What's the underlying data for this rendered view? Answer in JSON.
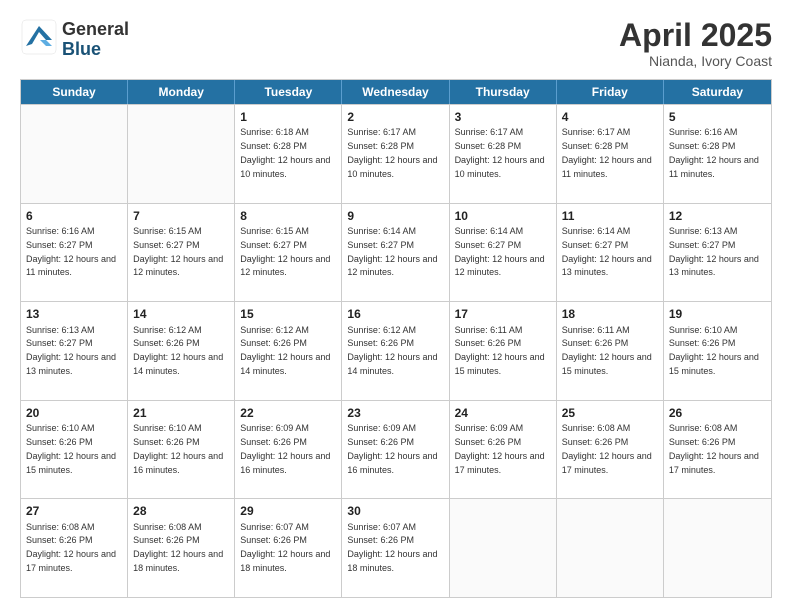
{
  "logo": {
    "general": "General",
    "blue": "Blue"
  },
  "title": "April 2025",
  "location": "Nianda, Ivory Coast",
  "header_days": [
    "Sunday",
    "Monday",
    "Tuesday",
    "Wednesday",
    "Thursday",
    "Friday",
    "Saturday"
  ],
  "weeks": [
    [
      {
        "day": "",
        "info": ""
      },
      {
        "day": "",
        "info": ""
      },
      {
        "day": "1",
        "info": "Sunrise: 6:18 AM\nSunset: 6:28 PM\nDaylight: 12 hours and 10 minutes."
      },
      {
        "day": "2",
        "info": "Sunrise: 6:17 AM\nSunset: 6:28 PM\nDaylight: 12 hours and 10 minutes."
      },
      {
        "day": "3",
        "info": "Sunrise: 6:17 AM\nSunset: 6:28 PM\nDaylight: 12 hours and 10 minutes."
      },
      {
        "day": "4",
        "info": "Sunrise: 6:17 AM\nSunset: 6:28 PM\nDaylight: 12 hours and 11 minutes."
      },
      {
        "day": "5",
        "info": "Sunrise: 6:16 AM\nSunset: 6:28 PM\nDaylight: 12 hours and 11 minutes."
      }
    ],
    [
      {
        "day": "6",
        "info": "Sunrise: 6:16 AM\nSunset: 6:27 PM\nDaylight: 12 hours and 11 minutes."
      },
      {
        "day": "7",
        "info": "Sunrise: 6:15 AM\nSunset: 6:27 PM\nDaylight: 12 hours and 12 minutes."
      },
      {
        "day": "8",
        "info": "Sunrise: 6:15 AM\nSunset: 6:27 PM\nDaylight: 12 hours and 12 minutes."
      },
      {
        "day": "9",
        "info": "Sunrise: 6:14 AM\nSunset: 6:27 PM\nDaylight: 12 hours and 12 minutes."
      },
      {
        "day": "10",
        "info": "Sunrise: 6:14 AM\nSunset: 6:27 PM\nDaylight: 12 hours and 12 minutes."
      },
      {
        "day": "11",
        "info": "Sunrise: 6:14 AM\nSunset: 6:27 PM\nDaylight: 12 hours and 13 minutes."
      },
      {
        "day": "12",
        "info": "Sunrise: 6:13 AM\nSunset: 6:27 PM\nDaylight: 12 hours and 13 minutes."
      }
    ],
    [
      {
        "day": "13",
        "info": "Sunrise: 6:13 AM\nSunset: 6:27 PM\nDaylight: 12 hours and 13 minutes."
      },
      {
        "day": "14",
        "info": "Sunrise: 6:12 AM\nSunset: 6:26 PM\nDaylight: 12 hours and 14 minutes."
      },
      {
        "day": "15",
        "info": "Sunrise: 6:12 AM\nSunset: 6:26 PM\nDaylight: 12 hours and 14 minutes."
      },
      {
        "day": "16",
        "info": "Sunrise: 6:12 AM\nSunset: 6:26 PM\nDaylight: 12 hours and 14 minutes."
      },
      {
        "day": "17",
        "info": "Sunrise: 6:11 AM\nSunset: 6:26 PM\nDaylight: 12 hours and 15 minutes."
      },
      {
        "day": "18",
        "info": "Sunrise: 6:11 AM\nSunset: 6:26 PM\nDaylight: 12 hours and 15 minutes."
      },
      {
        "day": "19",
        "info": "Sunrise: 6:10 AM\nSunset: 6:26 PM\nDaylight: 12 hours and 15 minutes."
      }
    ],
    [
      {
        "day": "20",
        "info": "Sunrise: 6:10 AM\nSunset: 6:26 PM\nDaylight: 12 hours and 15 minutes."
      },
      {
        "day": "21",
        "info": "Sunrise: 6:10 AM\nSunset: 6:26 PM\nDaylight: 12 hours and 16 minutes."
      },
      {
        "day": "22",
        "info": "Sunrise: 6:09 AM\nSunset: 6:26 PM\nDaylight: 12 hours and 16 minutes."
      },
      {
        "day": "23",
        "info": "Sunrise: 6:09 AM\nSunset: 6:26 PM\nDaylight: 12 hours and 16 minutes."
      },
      {
        "day": "24",
        "info": "Sunrise: 6:09 AM\nSunset: 6:26 PM\nDaylight: 12 hours and 17 minutes."
      },
      {
        "day": "25",
        "info": "Sunrise: 6:08 AM\nSunset: 6:26 PM\nDaylight: 12 hours and 17 minutes."
      },
      {
        "day": "26",
        "info": "Sunrise: 6:08 AM\nSunset: 6:26 PM\nDaylight: 12 hours and 17 minutes."
      }
    ],
    [
      {
        "day": "27",
        "info": "Sunrise: 6:08 AM\nSunset: 6:26 PM\nDaylight: 12 hours and 17 minutes."
      },
      {
        "day": "28",
        "info": "Sunrise: 6:08 AM\nSunset: 6:26 PM\nDaylight: 12 hours and 18 minutes."
      },
      {
        "day": "29",
        "info": "Sunrise: 6:07 AM\nSunset: 6:26 PM\nDaylight: 12 hours and 18 minutes."
      },
      {
        "day": "30",
        "info": "Sunrise: 6:07 AM\nSunset: 6:26 PM\nDaylight: 12 hours and 18 minutes."
      },
      {
        "day": "",
        "info": ""
      },
      {
        "day": "",
        "info": ""
      },
      {
        "day": "",
        "info": ""
      }
    ]
  ]
}
